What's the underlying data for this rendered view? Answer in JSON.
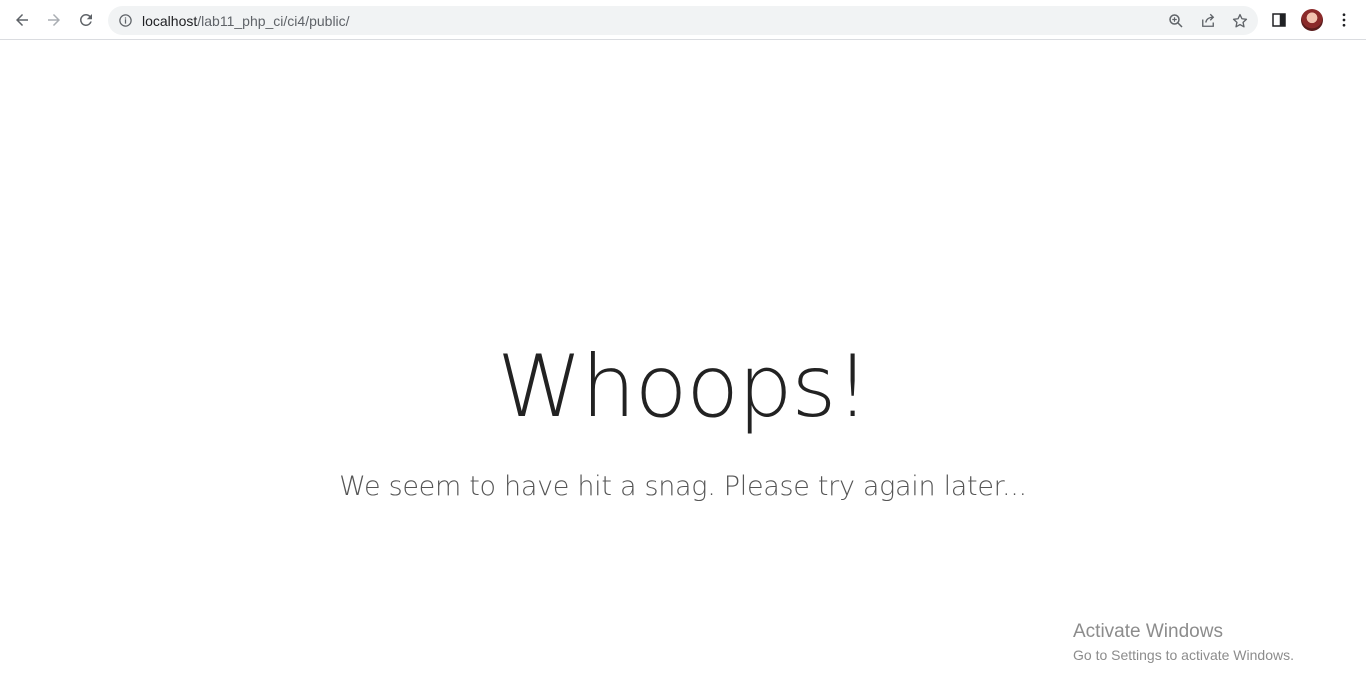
{
  "browser": {
    "url_host": "localhost",
    "url_path": "/lab11_php_ci/ci4/public/",
    "icons": {
      "back": "back-arrow-icon",
      "forward": "forward-arrow-icon",
      "reload": "reload-icon",
      "site_info": "info-icon",
      "zoom": "zoom-icon",
      "share": "share-icon",
      "bookmark": "star-icon",
      "side_panel": "side-panel-icon",
      "menu": "kebab-menu-icon"
    }
  },
  "page": {
    "headline": "Whoops!",
    "message": "We seem to have hit a snag. Please try again later..."
  },
  "watermark": {
    "title": "Activate Windows",
    "subtitle": "Go to Settings to activate Windows."
  },
  "colors": {
    "omnibox_bg": "#f1f3f4",
    "headline": "#222222",
    "message": "#555555",
    "watermark": "#8c8c8c"
  }
}
